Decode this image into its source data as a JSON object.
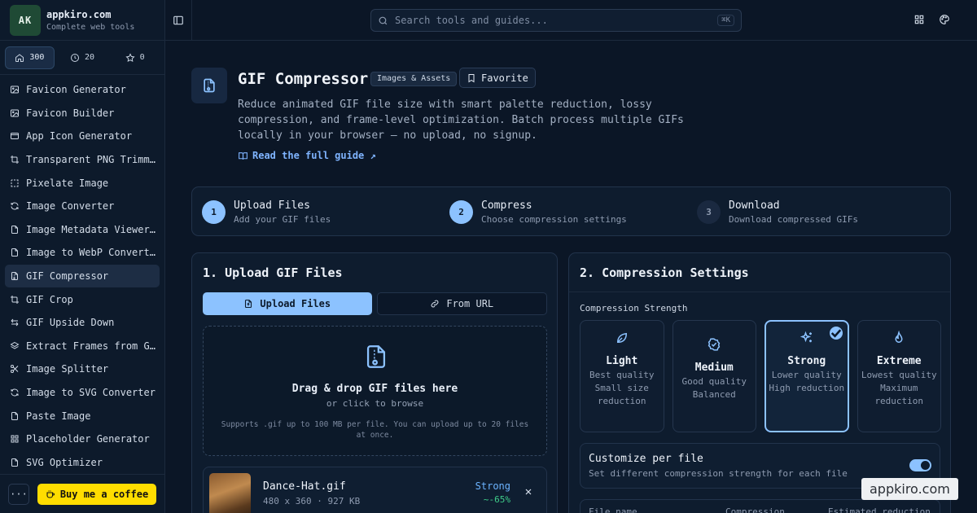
{
  "brand": {
    "initials": "AK",
    "name": "appkiro.com",
    "tagline": "Complete web tools"
  },
  "counters": [
    {
      "icon": "home-icon",
      "value": "300"
    },
    {
      "icon": "clock-icon",
      "value": "20"
    },
    {
      "icon": "star-icon",
      "value": "0"
    }
  ],
  "nav": [
    {
      "label": "Favicon Generator",
      "icon": "image-icon"
    },
    {
      "label": "Favicon Builder",
      "icon": "image-icon"
    },
    {
      "label": "App Icon Generator",
      "icon": "app-window-icon"
    },
    {
      "label": "Transparent PNG Trimm…",
      "icon": "crop-icon"
    },
    {
      "label": "Pixelate Image",
      "icon": "dashed-square-icon"
    },
    {
      "label": "Image Converter",
      "icon": "refresh-icon"
    },
    {
      "label": "Image Metadata Viewer…",
      "icon": "file-icon"
    },
    {
      "label": "Image to WebP Convert…",
      "icon": "file-icon"
    },
    {
      "label": "GIF Compressor",
      "icon": "file-zip-icon",
      "active": true
    },
    {
      "label": "GIF Crop",
      "icon": "crop-icon"
    },
    {
      "label": "GIF Upside Down",
      "icon": "flip-icon"
    },
    {
      "label": "Extract Frames from G…",
      "icon": "layers-icon"
    },
    {
      "label": "Image Splitter",
      "icon": "scissors-icon"
    },
    {
      "label": "Image to SVG Converter",
      "icon": "refresh-icon"
    },
    {
      "label": "Paste Image",
      "icon": "file-icon"
    },
    {
      "label": "Placeholder Generator",
      "icon": "grid-icon"
    },
    {
      "label": "SVG Optimizer",
      "icon": "file-icon"
    }
  ],
  "footer": {
    "more": "···",
    "coffee": "Buy me a coffee"
  },
  "search": {
    "placeholder": "Search tools and guides...",
    "shortcut": "⌘K"
  },
  "tool": {
    "title": "GIF Compressor",
    "category": "Images & Assets",
    "favorite": "Favorite",
    "description": "Reduce animated GIF file size with smart palette reduction, lossy compression, and frame-level optimization. Batch process multiple GIFs locally in your browser — no upload, no signup.",
    "guide": "Read the full guide ↗"
  },
  "steps": [
    {
      "num": "1",
      "title": "Upload Files",
      "sub": "Add your GIF files",
      "done": true
    },
    {
      "num": "2",
      "title": "Compress",
      "sub": "Choose compression settings",
      "done": true
    },
    {
      "num": "3",
      "title": "Download",
      "sub": "Download compressed GIFs",
      "done": false
    }
  ],
  "upload": {
    "heading": "1. Upload GIF Files",
    "tab_files": "Upload Files",
    "tab_url": "From URL",
    "drop_title": "Drag & drop GIF files here",
    "drop_sub": "or click to browse",
    "drop_note": "Supports .gif up to 100 MB per file. You can upload up to 20 files at once.",
    "file": {
      "name": "Dance-Hat.gif",
      "meta": "480 x 360 · 927 KB",
      "strength": "Strong",
      "reduction": "~-65%"
    }
  },
  "settings": {
    "heading": "2. Compression Settings",
    "strength_label": "Compression Strength",
    "options": [
      {
        "name": "Light",
        "desc": "Best quality Small size reduction",
        "icon": "leaf-icon",
        "selected": false
      },
      {
        "name": "Medium",
        "desc": "Good quality Balanced",
        "icon": "check-circle-icon",
        "selected": false
      },
      {
        "name": "Strong",
        "desc": "Lower quality High reduction",
        "icon": "sparkles-icon",
        "selected": true
      },
      {
        "name": "Extreme",
        "desc": "Lowest quality Maximum reduction",
        "icon": "flame-icon",
        "selected": false
      }
    ],
    "custom_title": "Customize per file",
    "custom_sub": "Set different compression strength for each file",
    "custom_enabled": true,
    "table_headers": [
      "File name",
      "Compression",
      "Estimated reduction"
    ]
  },
  "watermark": "appkiro.com",
  "colors": {
    "accent": "#8cc2ff",
    "coffee": "#ffdd00",
    "success": "#3fce8a",
    "background": "#0b1626"
  }
}
